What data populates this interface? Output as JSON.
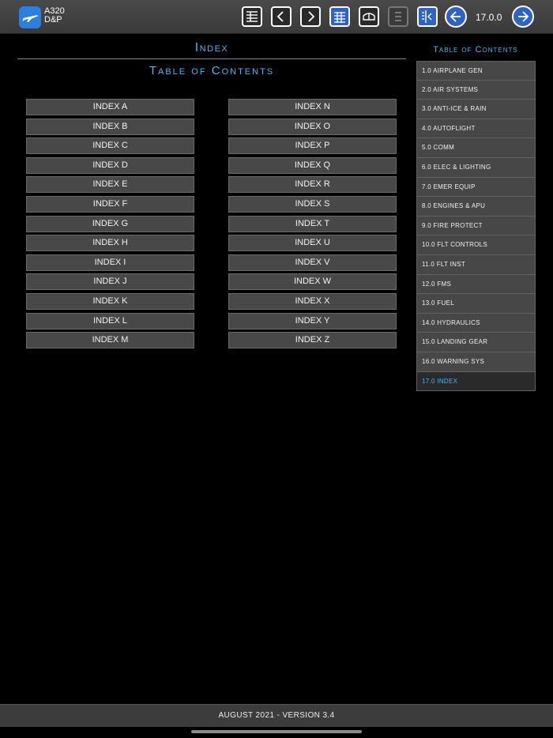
{
  "app": {
    "name_line1": "A320",
    "name_line2": "D&P"
  },
  "toolbar": {
    "page_number": "17.0.0",
    "icons": [
      "list-icon",
      "chevron-left-icon",
      "chevron-right-icon",
      "grid-icon",
      "window-icon",
      "lines-icon",
      "sidebar-icon",
      "arrow-left-circle-icon",
      "arrow-right-circle-icon"
    ]
  },
  "main": {
    "title": "Index",
    "subtitle": "Table of Contents",
    "left_column": [
      "INDEX A",
      "INDEX B",
      "INDEX C",
      "INDEX D",
      "INDEX E",
      "INDEX F",
      "INDEX G",
      "INDEX H",
      "INDEX I",
      "INDEX J",
      "INDEX K",
      "INDEX L",
      "INDEX M"
    ],
    "right_column": [
      "INDEX N",
      "INDEX O",
      "INDEX P",
      "INDEX Q",
      "INDEX R",
      "INDEX S",
      "INDEX T",
      "INDEX U",
      "INDEX V",
      "INDEX W",
      "INDEX X",
      "INDEX Y",
      "INDEX Z"
    ]
  },
  "sidebar": {
    "title": "Table of Contents",
    "items": [
      {
        "label": "1.0 AIRPLANE GEN"
      },
      {
        "label": "2.0 AIR SYSTEMS"
      },
      {
        "label": "3.0 ANTI-ICE & RAIN"
      },
      {
        "label": "4.0 AUTOFLIGHT"
      },
      {
        "label": "5.0 COMM"
      },
      {
        "label": "6.0 ELEC & LIGHTING"
      },
      {
        "label": "7.0 EMER EQUIP"
      },
      {
        "label": "8.0 ENGINES & APU"
      },
      {
        "label": "9.0 FIRE PROTECT"
      },
      {
        "label": "10.0 FLT CONTROLS"
      },
      {
        "label": "11.0 FLT INST"
      },
      {
        "label": "12.0 FMS"
      },
      {
        "label": "13.0 FUEL"
      },
      {
        "label": "14.0 HYDRAULICS"
      },
      {
        "label": "15.0 LANDING GEAR"
      },
      {
        "label": "16.0 WARNING SYS"
      },
      {
        "label": "17.0 INDEX"
      }
    ],
    "active_index": 16
  },
  "footer": {
    "text": "AUGUST 2021 - VERSION 3.4"
  },
  "colors": {
    "accent": "#48b6f0",
    "button_blue": "#2e63c6",
    "button_gray": "#484848"
  }
}
